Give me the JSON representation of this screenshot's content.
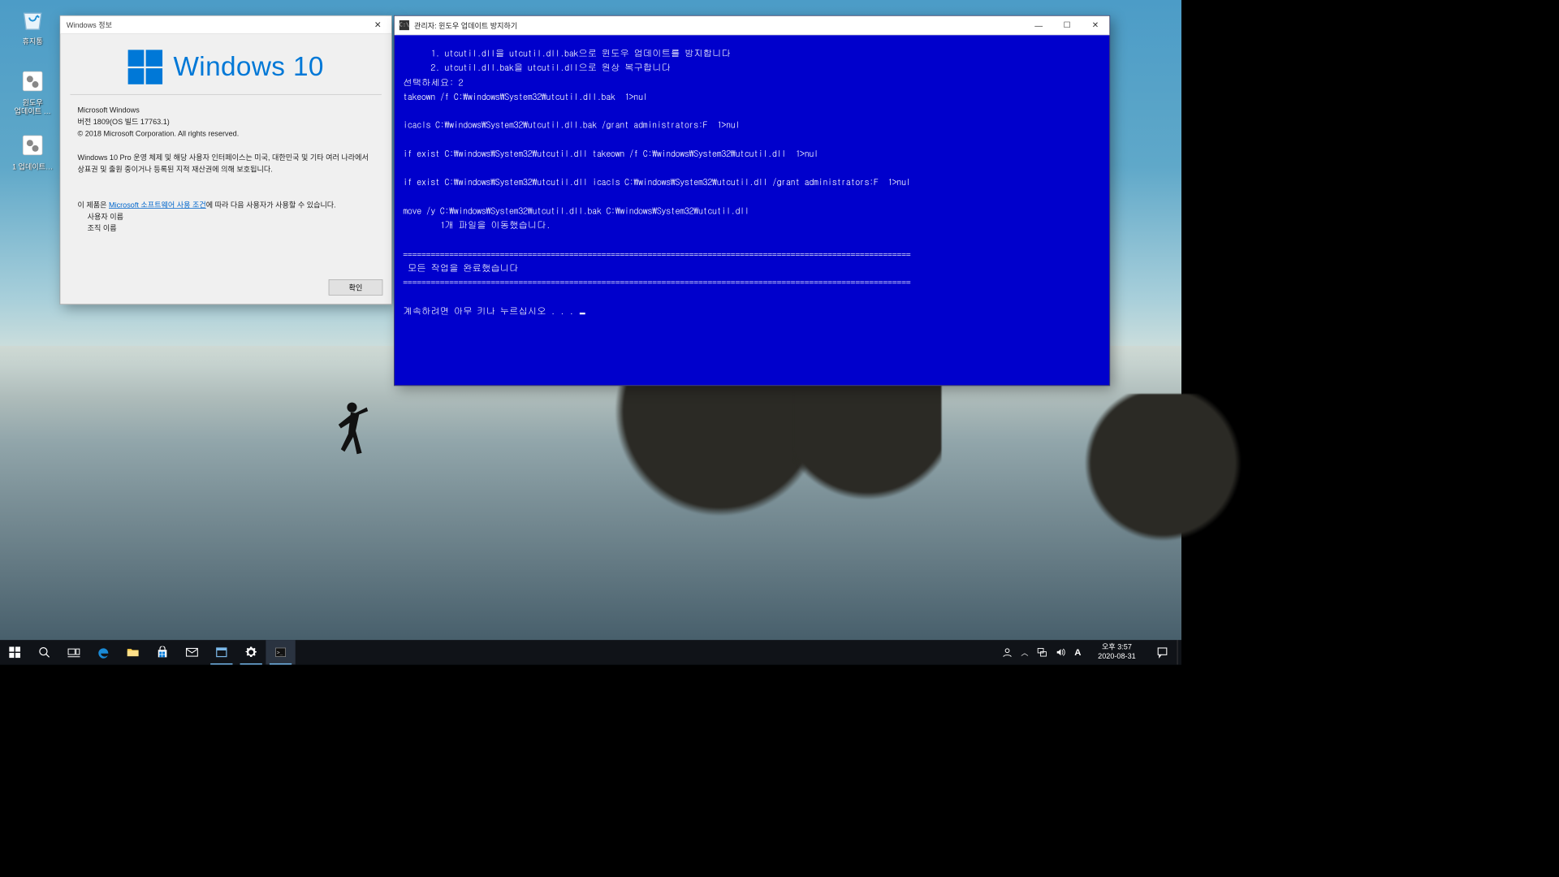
{
  "desktop": {
    "icons": [
      {
        "name": "recycle-bin",
        "label": "휴지통",
        "glyph": "recycle"
      },
      {
        "name": "windows-update-blocker",
        "label": "윈도우\n업데이트 …",
        "glyph": "gears"
      },
      {
        "name": "update-1",
        "label": "1 업데이트…",
        "glyph": "gears"
      }
    ]
  },
  "winver": {
    "title": "Windows 정보",
    "logo_text": "Windows 10",
    "product": "Microsoft Windows",
    "version_line": "버전 1809(OS 빌드 17763.1)",
    "copyright": "© 2018 Microsoft Corporation. All rights reserved.",
    "edition_text": "Windows 10 Pro 운영 체제 및 해당 사용자 인터페이스는 미국, 대한민국 및 기타 여러 나라에서 상표권 및 출원 중이거나 등록된 지적 재산권에 의해 보호됩니다.",
    "license_prefix": "이 제품은 ",
    "license_link": "Microsoft 소프트웨어 사용 조건",
    "license_suffix": "에 따라 다음 사용자가 사용할 수 있습니다.",
    "user_label": "사용자 이름",
    "org_label": "조직 이름",
    "ok_label": "확인"
  },
  "cmd": {
    "title": "관리자:  윈도우 업데이트 방지하기",
    "lines": [
      "      1. utcutil.dll을 utcutil.dll.bak으로 윈도우 업데이트를 방지합니다",
      "      2. utcutil.dll.bak을 utcutil.dll으로 원상 복구합니다",
      "선택하세요: 2",
      "",
      "takeown /f C:\\windows\\System32\\utcutil.dll.bak  1>nul",
      "",
      "icacls C:\\windows\\System32\\utcutil.dll.bak /grant administrators:F  1>nul",
      "",
      "if exist C:\\windows\\System32\\utcutil.dll takeown /f C:\\windows\\System32\\utcutil.dll  1>nul",
      "",
      "if exist C:\\windows\\System32\\utcutil.dll icacls C:\\windows\\System32\\utcutil.dll /grant administrators:F  1>nul",
      "",
      "move /y C:\\windows\\System32\\utcutil.dll.bak C:\\windows\\System32\\utcutil.dll",
      "        1개 파일을 이동했습니다."
    ],
    "divider": "==============================================================================================================",
    "done": " 모든 작업을 완료했습니다",
    "continue": "계속하려면 아무 키나 누르십시오 . . . "
  },
  "taskbar": {
    "ime": "A",
    "time": "오후 3:57",
    "date": "2020-08-31"
  }
}
